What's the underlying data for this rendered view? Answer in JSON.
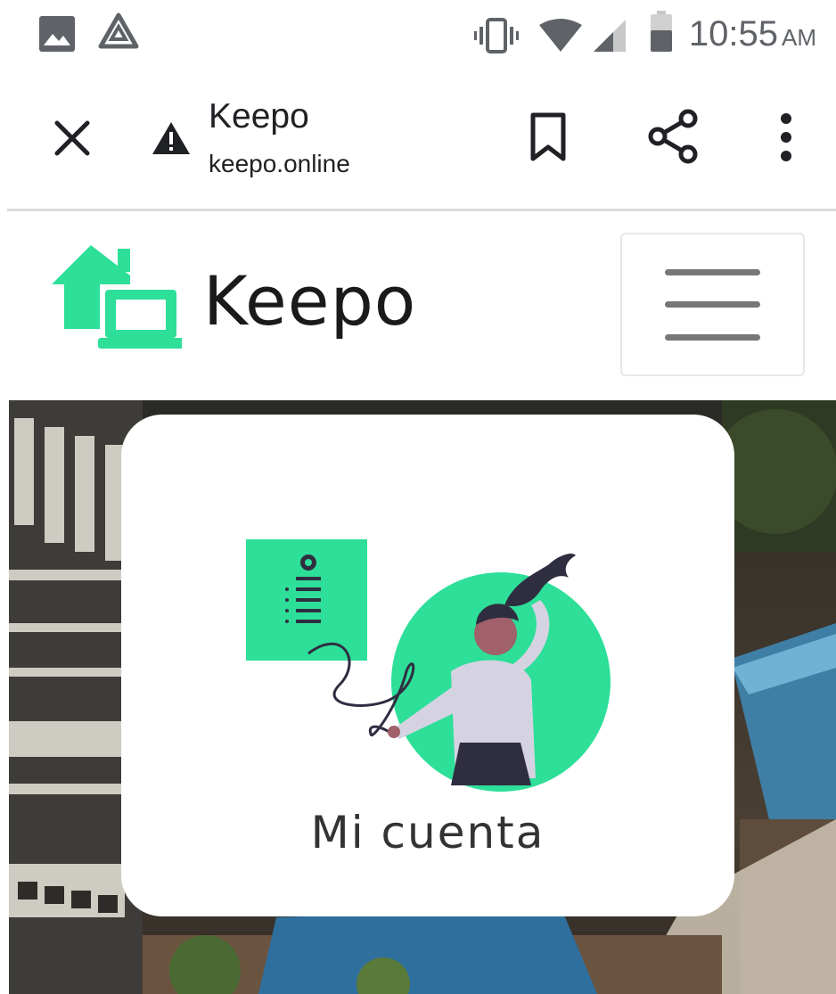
{
  "status_bar": {
    "time": "10:55",
    "ampm": "AM",
    "icons": [
      "image-icon",
      "drive-icon",
      "vibrate-icon",
      "wifi-icon",
      "signal-icon",
      "battery-icon"
    ]
  },
  "toolbar": {
    "title": "Keepo",
    "url": "keepo.online",
    "icons": [
      "close-icon",
      "warning-icon",
      "bookmark-icon",
      "share-icon",
      "more-vert-icon"
    ]
  },
  "site_header": {
    "brand": "Keepo",
    "icons": [
      "keepo-logo-icon",
      "hamburger-menu-icon"
    ]
  },
  "account_card": {
    "label": "Mi cuenta"
  },
  "colors": {
    "brand_green": "#2ddf98",
    "text_dark": "#1a1a1a",
    "status_grey": "#5f6368",
    "figure_dark": "#2f2e41"
  }
}
